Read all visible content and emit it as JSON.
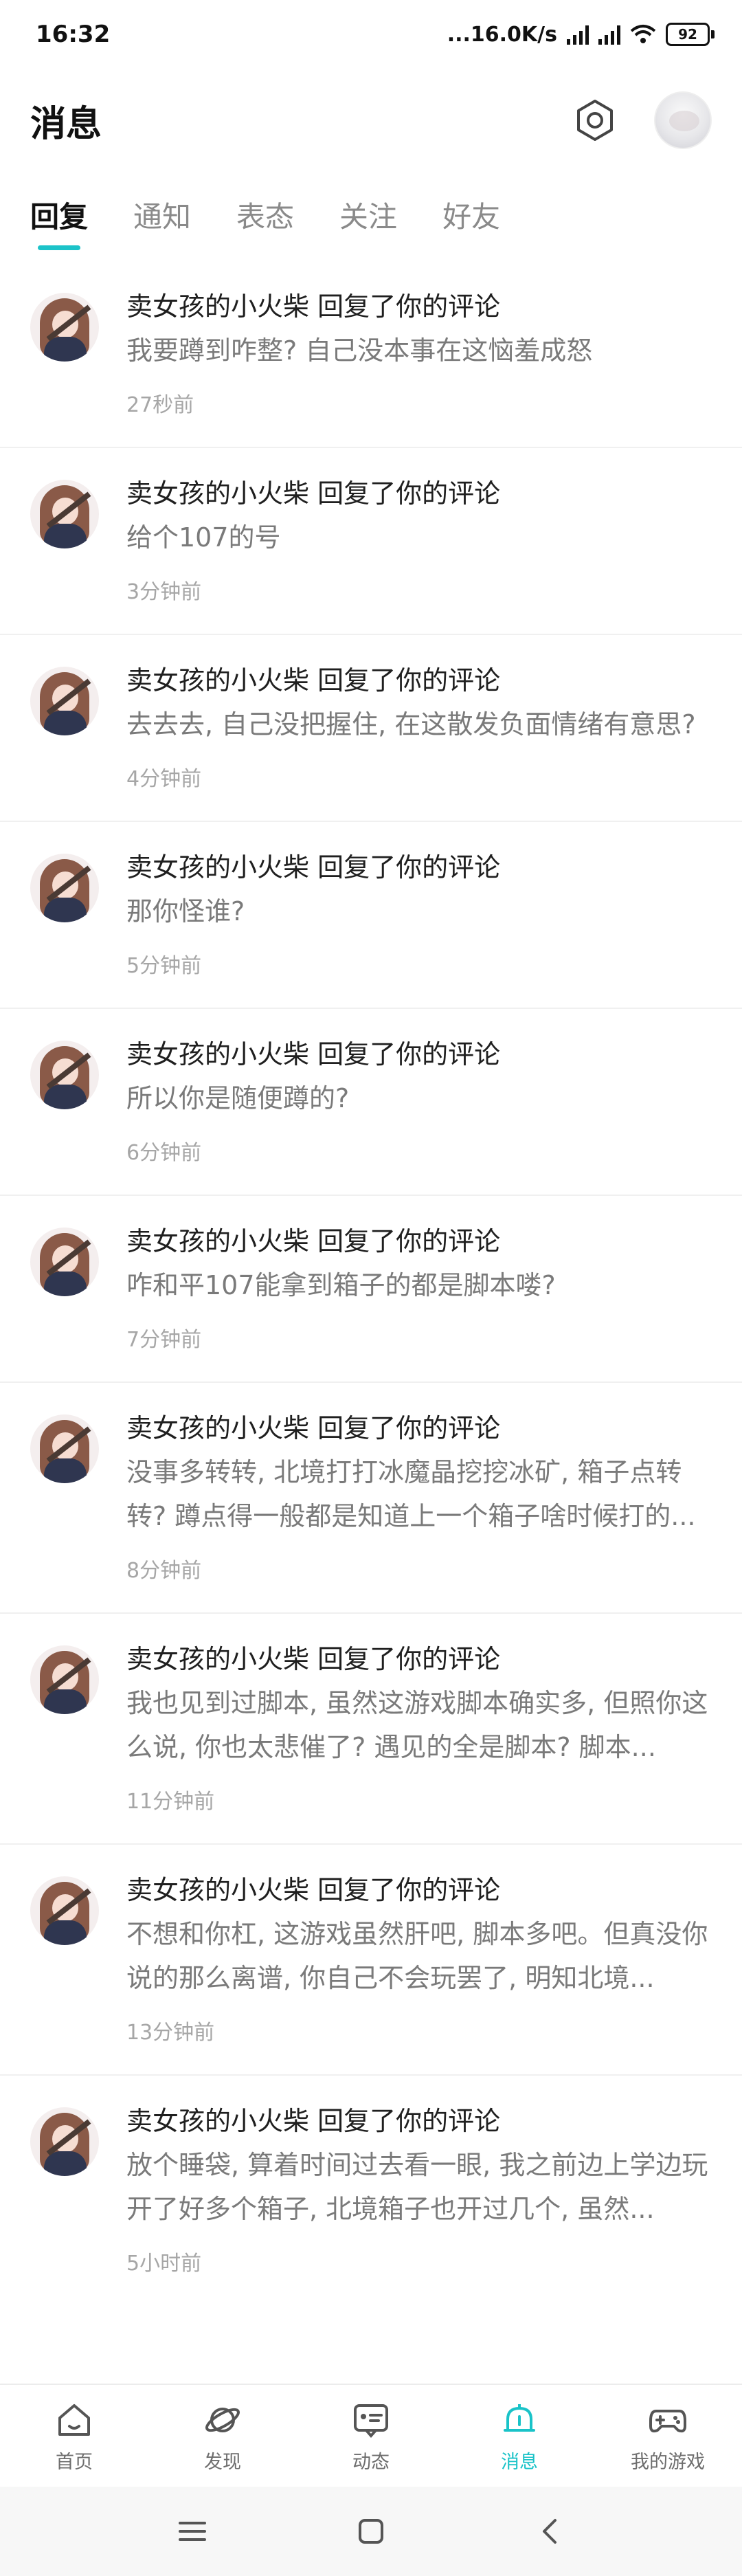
{
  "status_bar": {
    "time": "16:32",
    "network_speed": "...16.0K/s",
    "battery": "92"
  },
  "header": {
    "title": "消息"
  },
  "tabs": [
    {
      "label": "回复",
      "active": true
    },
    {
      "label": "通知",
      "active": false
    },
    {
      "label": "表态",
      "active": false
    },
    {
      "label": "关注",
      "active": false
    },
    {
      "label": "好友",
      "active": false
    }
  ],
  "messages": [
    {
      "user": "卖女孩的小火柴",
      "action": "回复了你的评论",
      "text": "我要蹲到咋整? 自己没本事在这恼羞成怒",
      "time": "27秒前"
    },
    {
      "user": "卖女孩的小火柴",
      "action": "回复了你的评论",
      "text": "给个107的号",
      "time": "3分钟前"
    },
    {
      "user": "卖女孩的小火柴",
      "action": "回复了你的评论",
      "text": "去去去, 自己没把握住, 在这散发负面情绪有意思?",
      "time": "4分钟前"
    },
    {
      "user": "卖女孩的小火柴",
      "action": "回复了你的评论",
      "text": "那你怪谁?",
      "time": "5分钟前"
    },
    {
      "user": "卖女孩的小火柴",
      "action": "回复了你的评论",
      "text": "所以你是随便蹲的?",
      "time": "6分钟前"
    },
    {
      "user": "卖女孩的小火柴",
      "action": "回复了你的评论",
      "text": "咋和平107能拿到箱子的都是脚本喽?",
      "time": "7分钟前"
    },
    {
      "user": "卖女孩的小火柴",
      "action": "回复了你的评论",
      "text": "没事多转转, 北境打打冰魔晶挖挖冰矿, 箱子点转转? 蹲点得一般都是知道上一个箱子啥时候打的...",
      "time": "8分钟前"
    },
    {
      "user": "卖女孩的小火柴",
      "action": "回复了你的评论",
      "text": "我也见到过脚本, 虽然这游戏脚本确实多, 但照你这么说, 你也太悲催了? 遇见的全是脚本? 脚本...",
      "time": "11分钟前"
    },
    {
      "user": "卖女孩的小火柴",
      "action": "回复了你的评论",
      "text": "不想和你杠, 这游戏虽然肝吧, 脚本多吧。但真没你说的那么离谱, 你自己不会玩罢了, 明知北境...",
      "time": "13分钟前"
    },
    {
      "user": "卖女孩的小火柴",
      "action": "回复了你的评论",
      "text": "放个睡袋, 算着时间过去看一眼, 我之前边上学边玩开了好多个箱子, 北境箱子也开过几个, 虽然...",
      "time": "5小时前"
    }
  ],
  "bottom_nav": [
    {
      "label": "首页",
      "icon": "home-icon",
      "active": false
    },
    {
      "label": "发现",
      "icon": "planet-icon",
      "active": false
    },
    {
      "label": "动态",
      "icon": "feed-icon",
      "active": false
    },
    {
      "label": "消息",
      "icon": "bell-icon",
      "active": true
    },
    {
      "label": "我的游戏",
      "icon": "gamepad-icon",
      "active": false
    }
  ],
  "colors": {
    "accent": "#1cc3c9",
    "text_primary": "#1f1f1f",
    "text_secondary": "#7a7a7a",
    "text_muted": "#a6a6a6"
  }
}
